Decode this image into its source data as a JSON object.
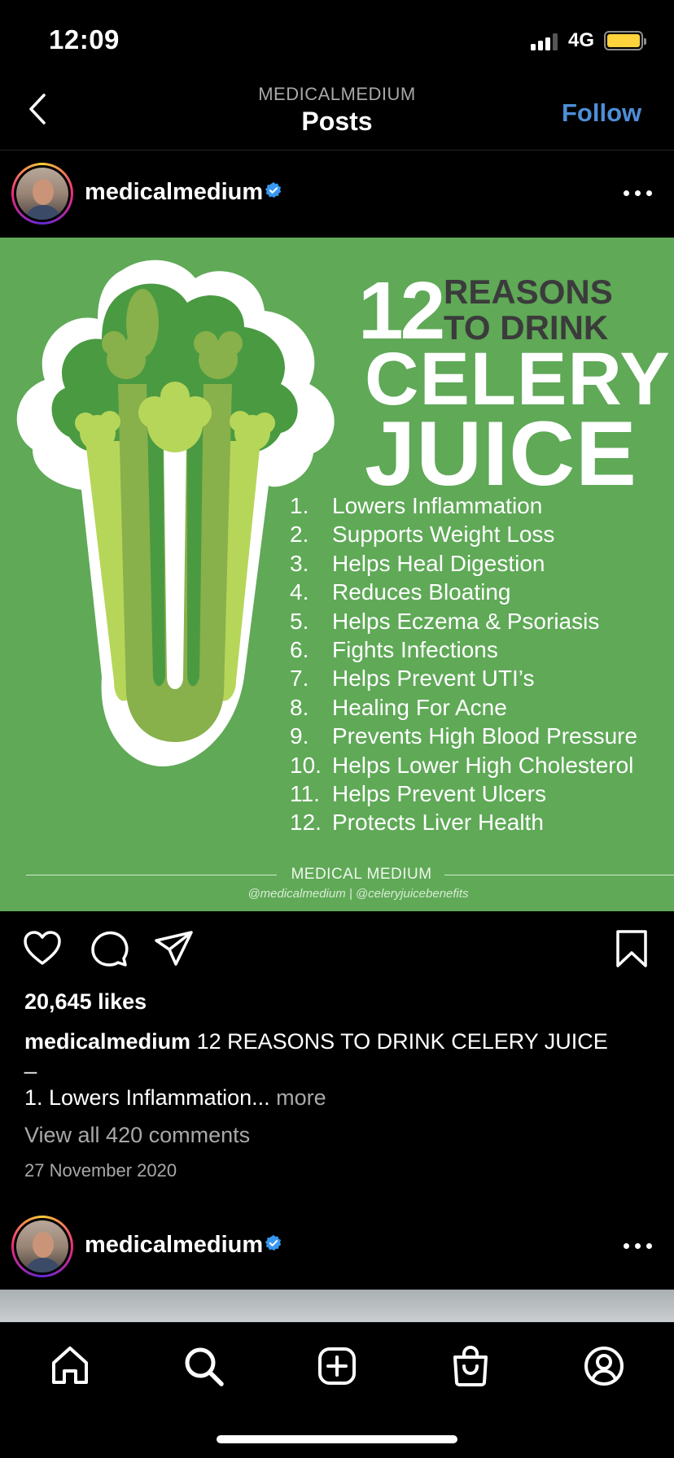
{
  "status_bar": {
    "time": "12:09",
    "network": "4G"
  },
  "nav": {
    "subtitle": "MEDICALMEDIUM",
    "title": "Posts",
    "follow_label": "Follow"
  },
  "post": {
    "username": "medicalmedium",
    "image": {
      "number": "12",
      "reasons_line1": "REASONS",
      "reasons_line2": "TO DRINK",
      "word_celery": "CELERY",
      "word_juice": "JUICE",
      "reasons": [
        {
          "n": "1.",
          "text": "Lowers Inflammation"
        },
        {
          "n": "2.",
          "text": "Supports Weight Loss"
        },
        {
          "n": "3.",
          "text": "Helps Heal Digestion"
        },
        {
          "n": "4.",
          "text": "Reduces Bloating"
        },
        {
          "n": "5.",
          "text": "Helps Eczema & Psoriasis"
        },
        {
          "n": "6.",
          "text": "Fights Infections"
        },
        {
          "n": "7.",
          "text": "Helps Prevent UTI’s"
        },
        {
          "n": "8.",
          "text": "Healing For Acne"
        },
        {
          "n": "9.",
          "text": "Prevents High Blood Pressure"
        },
        {
          "n": "10.",
          "text": "Helps Lower High Cholesterol"
        },
        {
          "n": "11.",
          "text": "Helps Prevent Ulcers"
        },
        {
          "n": "12.",
          "text": "Protects Liver Health"
        }
      ],
      "brand": "MEDICAL MEDIUM",
      "handles": "@medicalmedium | @celeryjuicebenefits"
    },
    "likes": "20,645 likes",
    "caption_user": "medicalmedium",
    "caption_text": "12 REASONS TO DRINK CELERY JUICE",
    "caption_dash": "_",
    "caption_line2": "1. Lowers Inflammation...",
    "more_label": "more",
    "view_comments": "View all 420 comments",
    "date": "27 November 2020"
  },
  "next_post": {
    "username": "medicalmedium"
  },
  "icons": {
    "action_bar": [
      "heart-icon",
      "comment-icon",
      "share-icon",
      "bookmark-icon"
    ],
    "tab_bar": [
      "home-icon",
      "search-icon",
      "new-post-icon",
      "shop-icon",
      "profile-icon"
    ]
  },
  "colors": {
    "background": "#000000",
    "accent": "#4d8fd7",
    "verified": "#3897f0",
    "image_green": "#5fa957",
    "muted_text": "#a8a8a8"
  }
}
